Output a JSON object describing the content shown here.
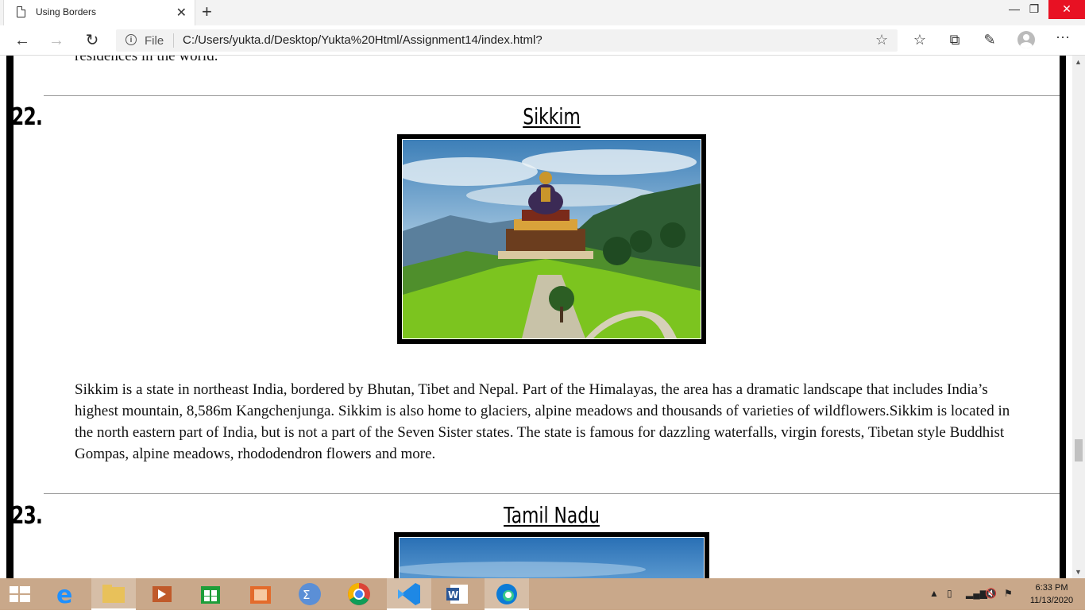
{
  "browser": {
    "tab_title": "Using Borders",
    "file_label": "File",
    "url": "C:/Users/yukta.d/Desktop/Yukta%20Html/Assignment14/index.html?"
  },
  "page": {
    "prev_text": "residences in the world.",
    "sections": [
      {
        "number": "22.",
        "title": "Sikkim",
        "paragraph": "Sikkim is a state in northeast India, bordered by Bhutan, Tibet and Nepal. Part of the Himalayas, the area has a dramatic landscape that includes India’s highest mountain, 8,586m Kangchenjunga. Sikkim is also home to glaciers, alpine meadows and thousands of varieties of wildflowers.Sikkim is located in the north eastern part of India, but is not a part of the Seven Sister states. The state is famous for dazzling waterfalls, virgin forests, Tibetan style Buddhist Gompas, alpine meadows, rhododendron flowers and more."
      },
      {
        "number": "23.",
        "title": "Tamil Nadu"
      }
    ]
  },
  "taskbar": {
    "time": "6:33 PM",
    "date": "11/13/2020"
  },
  "colors": {
    "close_red": "#e81123",
    "taskbar": "#c9a88a"
  }
}
